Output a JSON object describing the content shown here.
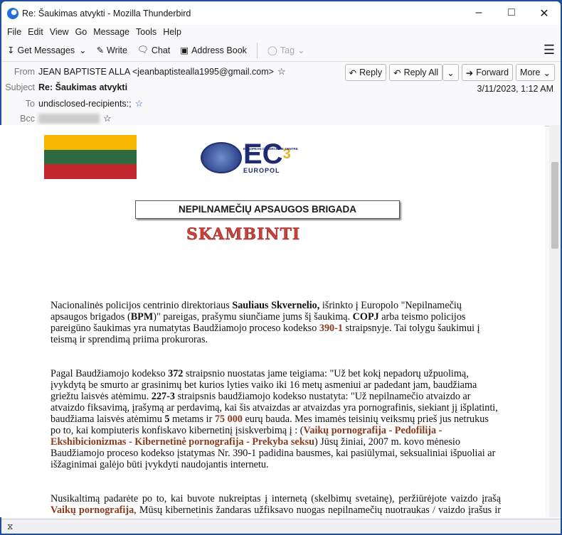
{
  "window": {
    "title": "Re: Šaukimas atvykti - Mozilla Thunderbird"
  },
  "menu": [
    "File",
    "Edit",
    "View",
    "Go",
    "Message",
    "Tools",
    "Help"
  ],
  "toolbar": {
    "get_messages": "Get Messages",
    "write": "Write",
    "chat": "Chat",
    "address_book": "Address Book",
    "tag": "Tag"
  },
  "header": {
    "from_label": "From",
    "from": "JEAN BAPTISTE ALLA <jeanbaptistealla1995@gmail.com>",
    "subject_label": "Subject",
    "subject": "Re: Šaukimas atvykti",
    "to_label": "To",
    "to": "undisclosed-recipients:;",
    "bcc_label": "Bcc",
    "date": "3/11/2023, 1:12 AM",
    "reply": "Reply",
    "reply_all": "Reply All",
    "forward": "Forward",
    "more": "More"
  },
  "message": {
    "logo_top": "EUROPEAN CYBERCRIME CENTRE",
    "logo_ec": "EC",
    "logo_sup": "3",
    "logo_europol": "EUROPOL",
    "brigade": "NEPILNAMEČIŲ APSAUGOS BRIGADA",
    "call": "SKAMBINTI",
    "p1": [
      "Nacionalinės policijos centrinio direktoriaus ",
      "Sauliaus Skvernelio,",
      " išrinkto į Europolo \"Nepilnamečių apsaugos brigados (",
      "BPM",
      ")\" pareigas, prašymu siunčiame jums šį šaukimą. ",
      "COPJ",
      " arba teismo policijos pareigūno šaukimas yra numatytas Baudžiamojo proceso kodekso ",
      "390-1",
      " straipsnyje. Tai tolygu šaukimui į teismą ir sprendimą priima prokuroras."
    ],
    "p2": [
      "Pagal Baudžiamojo kodekso ",
      "372",
      " straipsnio nuostatas jame teigiama: \"Už bet kokį nepadorų užpuolimą, įvykdytą be smurto ar grasinimų bet kurios lyties vaiko iki 16 metų asmeniui ar padedant jam, baudžiama griežtu laisvės atėmimu. ",
      "227-3",
      " straipsnis baudžiamojo kodekso nustatyta: \"Už nepilnamečio atvaizdo ar atvaizdo fiksavimą, įrašymą ar perdavimą, kai šis atvaizdas ar atvaizdas yra pornografinis, siekiant jį išplatinti, baudžiama laisvės atėmimu ",
      "5",
      " metams ir ",
      "75 000",
      " eurų bauda. Mes imamės teisinių veiksmų prieš jus netrukus po to, kai kompiuteris konfiskavo kibernetinį įsiskverbimą į : (",
      "Vaikų pornografija - Pedofilija - Ekshibicionizmas - Kibernetinė pornografija - Prekyba seksu",
      ") Jūsų žiniai, 2007 m. kovo mėnesio Baudžiamojo proceso kodekso įstatymas Nr. 390-1 padidina bausmes, kai pasiūlymai, seksualiniai išpuoliai ar išžaginimai galėjo būti įvykdyti naudojantis internetu."
    ],
    "p3": [
      "Nusikaltimą padarėte po to, kai buvote nukreiptas į internetą (skelbimų svetainę), peržiūrėjote vaizdo įrašą ",
      "Vaikų pornografija",
      ", Mūsų kibernetinis žandaras užfiksavo nuogas nepilnamečių nuotraukas / vaizdo įrašus ir yra jūsų nusikaltimų įrodymas. Konfidencialumo sumetimais mes jums siunčiame šį el. laišką, jūsų prašoma"
    ]
  },
  "colors": {
    "accent_red": "#8b3a1e",
    "skambinti": "#c9413b",
    "flag": [
      "#f5b700",
      "#2d6a41",
      "#c1272d"
    ]
  }
}
